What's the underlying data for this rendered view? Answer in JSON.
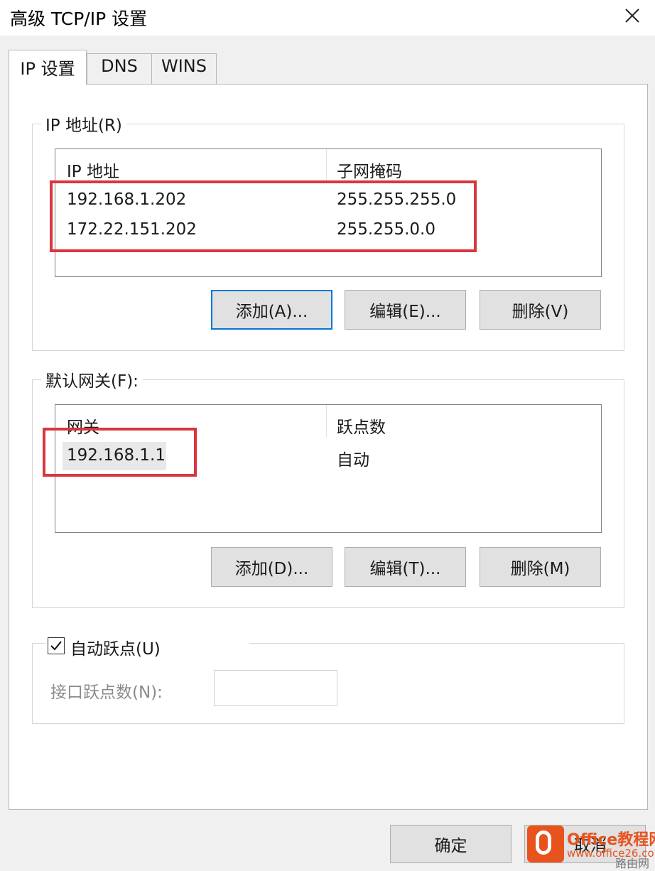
{
  "window": {
    "title": "高级 TCP/IP 设置"
  },
  "tabs": [
    {
      "label": "IP 设置"
    },
    {
      "label": "DNS"
    },
    {
      "label": "WINS"
    }
  ],
  "ip_section": {
    "legend": "IP 地址(R)",
    "columns": [
      "IP 地址",
      "子网掩码"
    ],
    "rows": [
      {
        "ip": "192.168.1.202",
        "mask": "255.255.255.0"
      },
      {
        "ip": "172.22.151.202",
        "mask": "255.255.0.0"
      }
    ],
    "buttons": {
      "add": "添加(A)...",
      "edit": "编辑(E)...",
      "remove": "删除(V)"
    }
  },
  "gateway_section": {
    "legend": "默认网关(F):",
    "columns": [
      "网关",
      "跃点数"
    ],
    "rows": [
      {
        "gateway": "192.168.1.1",
        "metric": "自动"
      }
    ],
    "buttons": {
      "add": "添加(D)...",
      "edit": "编辑(T)...",
      "remove": "删除(M)"
    }
  },
  "metric_section": {
    "auto_metric_label": "自动跃点(U)",
    "auto_metric_checked": true,
    "interface_metric_label": "接口跃点数(N):",
    "interface_metric_value": ""
  },
  "footer": {
    "ok": "确定",
    "cancel": "取消"
  },
  "watermark": {
    "brand": "Office教程网",
    "url": "www.office26.com",
    "corner": "路由网"
  },
  "colors": {
    "highlight": "#d9363e",
    "default_button_border": "#0078d7"
  }
}
